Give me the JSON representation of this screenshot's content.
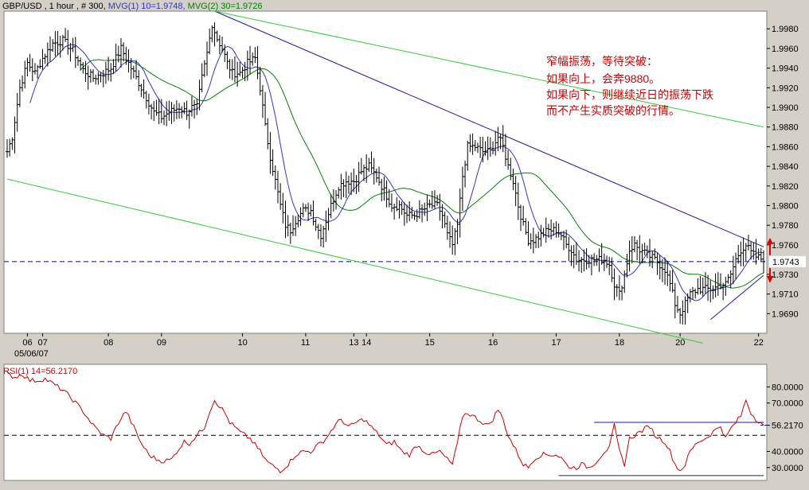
{
  "chart_data": [
    {
      "type": "ohlc",
      "title_parts": {
        "symbol": "GBP/USD , 1 hour , # 300, ",
        "mvg1": "MVG(1) 10=1.9748, ",
        "mvg2": "MVG(2) 30=1.9726"
      },
      "colors": {
        "price": "#000000",
        "mvg1": "#3333cc",
        "mvg2": "#008000",
        "trendline_blue": "#1a1a99",
        "channel_green": "#33cc33",
        "dashed": "#000099",
        "arrows": "#dd0000",
        "annotation": "#cc0000"
      },
      "ylim": [
        1.967,
        1.9998
      ],
      "y_ticks": [
        "1.9980",
        "1.9960",
        "1.9940",
        "1.9920",
        "1.9900",
        "1.9880",
        "1.9860",
        "1.9840",
        "1.9820",
        "1.9800",
        "1.9780",
        "1.9760",
        "1.9730",
        "1.9710",
        "1.9690"
      ],
      "y_tick_values": [
        1.998,
        1.996,
        1.994,
        1.992,
        1.99,
        1.988,
        1.986,
        1.984,
        1.982,
        1.98,
        1.978,
        1.976,
        1.973,
        1.971,
        1.969
      ],
      "current_value_label": "1.9743",
      "current_value": 1.9743,
      "date_labels": [
        {
          "text": "06",
          "bar": 8
        },
        {
          "text": "07",
          "bar": 14
        },
        {
          "text": "08",
          "bar": 40
        },
        {
          "text": "09",
          "bar": 61
        },
        {
          "text": "10",
          "bar": 93
        },
        {
          "text": "11",
          "bar": 118
        },
        {
          "text": "13",
          "bar": 137
        },
        {
          "text": "14",
          "bar": 142
        },
        {
          "text": "15",
          "bar": 167
        },
        {
          "text": "16",
          "bar": 192
        },
        {
          "text": "17",
          "bar": 217
        },
        {
          "text": "18",
          "bar": 242
        },
        {
          "text": "20",
          "bar": 266
        },
        {
          "text": "22",
          "bar": 297
        }
      ],
      "start_date_label": "05/06/07",
      "annotation_lines": [
        "窄幅振荡，等待突破：",
        "如果向上，会奔9880。",
        "如果向下，则继续近日的振荡下跌",
        "而不产生实质突破的行情。"
      ],
      "price_anchors": [
        [
          0,
          1.9855
        ],
        [
          2,
          1.987
        ],
        [
          5,
          1.992
        ],
        [
          8,
          1.9945
        ],
        [
          11,
          1.9935
        ],
        [
          14,
          1.995
        ],
        [
          18,
          1.9965
        ],
        [
          22,
          1.9968
        ],
        [
          26,
          1.9958
        ],
        [
          30,
          1.9938
        ],
        [
          34,
          1.993
        ],
        [
          38,
          1.9935
        ],
        [
          41,
          1.994
        ],
        [
          45,
          1.996
        ],
        [
          49,
          1.994
        ],
        [
          52,
          1.9925
        ],
        [
          55,
          1.991
        ],
        [
          58,
          1.9895
        ],
        [
          61,
          1.989
        ],
        [
          64,
          1.9895
        ],
        [
          68,
          1.99
        ],
        [
          71,
          1.9895
        ],
        [
          73,
          1.99
        ],
        [
          75,
          1.99
        ],
        [
          77,
          1.993
        ],
        [
          79,
          1.9955
        ],
        [
          81,
          1.9985
        ],
        [
          83,
          1.997
        ],
        [
          85,
          1.996
        ],
        [
          87,
          1.9945
        ],
        [
          89,
          1.9935
        ],
        [
          92,
          1.9935
        ],
        [
          95,
          1.9945
        ],
        [
          98,
          1.995
        ],
        [
          100,
          1.992
        ],
        [
          102,
          1.988
        ],
        [
          104,
          1.985
        ],
        [
          106,
          1.9825
        ],
        [
          108,
          1.98
        ],
        [
          110,
          1.978
        ],
        [
          112,
          1.9775
        ],
        [
          114,
          1.9785
        ],
        [
          117,
          1.9795
        ],
        [
          120,
          1.9795
        ],
        [
          122,
          1.978
        ],
        [
          124,
          1.977
        ],
        [
          126,
          1.9785
        ],
        [
          128,
          1.98
        ],
        [
          131,
          1.982
        ],
        [
          134,
          1.9825
        ],
        [
          137,
          1.9825
        ],
        [
          140,
          1.9835
        ],
        [
          143,
          1.984
        ],
        [
          146,
          1.983
        ],
        [
          149,
          1.9815
        ],
        [
          152,
          1.98
        ],
        [
          155,
          1.98
        ],
        [
          158,
          1.979
        ],
        [
          161,
          1.979
        ],
        [
          164,
          1.9795
        ],
        [
          167,
          1.98
        ],
        [
          170,
          1.98
        ],
        [
          172,
          1.979
        ],
        [
          174,
          1.977
        ],
        [
          176,
          1.976
        ],
        [
          178,
          1.978
        ],
        [
          180,
          1.983
        ],
        [
          182,
          1.986
        ],
        [
          185,
          1.986
        ],
        [
          188,
          1.9855
        ],
        [
          191,
          1.9855
        ],
        [
          194,
          1.987
        ],
        [
          196,
          1.986
        ],
        [
          198,
          1.984
        ],
        [
          200,
          1.9825
        ],
        [
          202,
          1.98
        ],
        [
          204,
          1.978
        ],
        [
          206,
          1.9765
        ],
        [
          208,
          1.9765
        ],
        [
          211,
          1.977
        ],
        [
          214,
          1.9775
        ],
        [
          217,
          1.9775
        ],
        [
          219,
          1.977
        ],
        [
          221,
          1.976
        ],
        [
          223,
          1.9755
        ],
        [
          225,
          1.9745
        ],
        [
          227,
          1.9745
        ],
        [
          230,
          1.9745
        ],
        [
          233,
          1.9745
        ],
        [
          236,
          1.9745
        ],
        [
          238,
          1.974
        ],
        [
          240,
          1.972
        ],
        [
          242,
          1.971
        ],
        [
          244,
          1.973
        ],
        [
          246,
          1.9755
        ],
        [
          248,
          1.976
        ],
        [
          250,
          1.9755
        ],
        [
          253,
          1.975
        ],
        [
          256,
          1.9745
        ],
        [
          258,
          1.974
        ],
        [
          260,
          1.9735
        ],
        [
          262,
          1.972
        ],
        [
          264,
          1.97
        ],
        [
          266,
          1.969
        ],
        [
          268,
          1.97
        ],
        [
          270,
          1.971
        ],
        [
          273,
          1.9715
        ],
        [
          276,
          1.9715
        ],
        [
          279,
          1.9715
        ],
        [
          282,
          1.972
        ],
        [
          284,
          1.972
        ],
        [
          286,
          1.973
        ],
        [
          288,
          1.9745
        ],
        [
          290,
          1.9755
        ],
        [
          292,
          1.976
        ],
        [
          294,
          1.9752
        ],
        [
          296,
          1.9748
        ],
        [
          298,
          1.9746
        ],
        [
          299,
          1.9743
        ]
      ],
      "trendlines": [
        {
          "from": [
            82,
            1.9998
          ],
          "to": [
            299,
            1.9758
          ],
          "color": "trendline_blue"
        },
        {
          "from": [
            278,
            1.9684
          ],
          "to": [
            299,
            1.9729
          ],
          "color": "trendline_blue"
        },
        {
          "from": [
            82,
            1.9998
          ],
          "to": [
            299,
            1.988
          ],
          "color": "channel_green"
        },
        {
          "from": [
            0,
            1.9827
          ],
          "to": [
            275,
            1.966
          ],
          "color": "channel_green"
        }
      ]
    },
    {
      "type": "line",
      "title": "RSI(1) 14=56.2170",
      "color": "#cc0000",
      "ylim": [
        22,
        94
      ],
      "y_ticks": [
        "80.0000",
        "70.0000",
        "56.2170",
        "40.0000",
        "30.0000"
      ],
      "y_tick_values": [
        80,
        70,
        56.217,
        40,
        30
      ],
      "dashed_level": 50,
      "rsi_anchors": [
        [
          0,
          88
        ],
        [
          3,
          86
        ],
        [
          6,
          88
        ],
        [
          9,
          84
        ],
        [
          12,
          84
        ],
        [
          15,
          85
        ],
        [
          18,
          82
        ],
        [
          22,
          78
        ],
        [
          26,
          72
        ],
        [
          30,
          65
        ],
        [
          34,
          56
        ],
        [
          38,
          50
        ],
        [
          41,
          48
        ],
        [
          44,
          58
        ],
        [
          47,
          65
        ],
        [
          50,
          55
        ],
        [
          53,
          45
        ],
        [
          56,
          38
        ],
        [
          59,
          35
        ],
        [
          62,
          34
        ],
        [
          65,
          35
        ],
        [
          67,
          40
        ],
        [
          70,
          46
        ],
        [
          72,
          45
        ],
        [
          75,
          50
        ],
        [
          78,
          55
        ],
        [
          80,
          65
        ],
        [
          82,
          72
        ],
        [
          84,
          68
        ],
        [
          86,
          64
        ],
        [
          88,
          58
        ],
        [
          90,
          55
        ],
        [
          92,
          52
        ],
        [
          94,
          50
        ],
        [
          96,
          48
        ],
        [
          98,
          44
        ],
        [
          100,
          40
        ],
        [
          102,
          35
        ],
        [
          104,
          32
        ],
        [
          106,
          30
        ],
        [
          108,
          28
        ],
        [
          111,
          32
        ],
        [
          114,
          38
        ],
        [
          117,
          40
        ],
        [
          120,
          40
        ],
        [
          123,
          44
        ],
        [
          126,
          48
        ],
        [
          129,
          55
        ],
        [
          132,
          60
        ],
        [
          135,
          55
        ],
        [
          138,
          58
        ],
        [
          141,
          60
        ],
        [
          144,
          55
        ],
        [
          147,
          50
        ],
        [
          150,
          44
        ],
        [
          153,
          46
        ],
        [
          156,
          40
        ],
        [
          159,
          38
        ],
        [
          162,
          44
        ],
        [
          165,
          40
        ],
        [
          168,
          38
        ],
        [
          171,
          40
        ],
        [
          174,
          35
        ],
        [
          176,
          32
        ],
        [
          178,
          45
        ],
        [
          180,
          62
        ],
        [
          182,
          64
        ],
        [
          184,
          62
        ],
        [
          186,
          60
        ],
        [
          188,
          58
        ],
        [
          190,
          56
        ],
        [
          192,
          60
        ],
        [
          194,
          66
        ],
        [
          196,
          60
        ],
        [
          198,
          50
        ],
        [
          200,
          44
        ],
        [
          202,
          38
        ],
        [
          204,
          32
        ],
        [
          206,
          30
        ],
        [
          208,
          35
        ],
        [
          211,
          38
        ],
        [
          214,
          38
        ],
        [
          217,
          38
        ],
        [
          219,
          36
        ],
        [
          221,
          32
        ],
        [
          223,
          30
        ],
        [
          225,
          30
        ],
        [
          227,
          32
        ],
        [
          230,
          30
        ],
        [
          233,
          34
        ],
        [
          236,
          40
        ],
        [
          238,
          42
        ],
        [
          240,
          56
        ],
        [
          242,
          40
        ],
        [
          244,
          32
        ],
        [
          246,
          48
        ],
        [
          248,
          50
        ],
        [
          250,
          52
        ],
        [
          252,
          54
        ],
        [
          254,
          56
        ],
        [
          256,
          50
        ],
        [
          258,
          48
        ],
        [
          260,
          46
        ],
        [
          262,
          40
        ],
        [
          264,
          32
        ],
        [
          266,
          28
        ],
        [
          268,
          32
        ],
        [
          270,
          40
        ],
        [
          273,
          46
        ],
        [
          276,
          48
        ],
        [
          279,
          52
        ],
        [
          282,
          56
        ],
        [
          284,
          48
        ],
        [
          286,
          54
        ],
        [
          288,
          58
        ],
        [
          290,
          62
        ],
        [
          292,
          72
        ],
        [
          294,
          64
        ],
        [
          296,
          60
        ],
        [
          298,
          58
        ],
        [
          299,
          56.217
        ]
      ],
      "hlines": [
        {
          "from": [
            232,
            58
          ],
          "to": [
            299,
            58
          ]
        },
        {
          "from": [
            218,
            25
          ],
          "to": [
            299,
            25
          ]
        }
      ]
    }
  ]
}
